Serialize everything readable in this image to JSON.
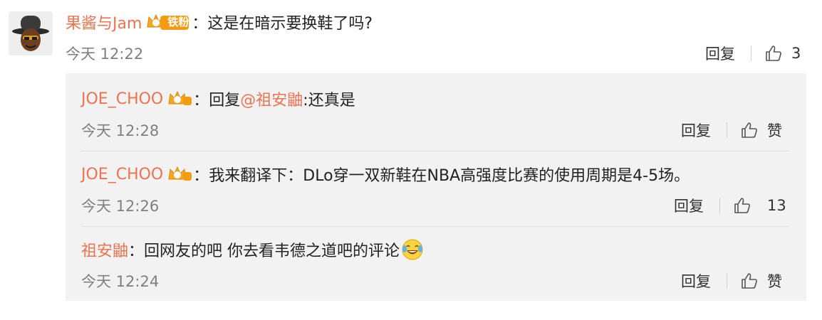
{
  "main_comment": {
    "username": "果酱与Jam",
    "badge_text": "铁粉",
    "separator": "：",
    "text": "这是在暗示要换鞋了吗?",
    "time": "今天 12:22",
    "reply_label": "回复",
    "like_count": "3"
  },
  "replies": [
    {
      "username": "JOE_CHOO",
      "separator": "：",
      "reply_prefix": "回复",
      "mention": "@祖安鼬",
      "text": ":还真是",
      "time": "今天 12:28",
      "reply_label": "回复",
      "like_label": "赞"
    },
    {
      "username": "JOE_CHOO",
      "separator": "：",
      "text": "我来翻译下：DLo穿一双新鞋在NBA高强度比赛的使用周期是4-5场。",
      "time": "今天 12:26",
      "reply_label": "回复",
      "like_count": "13"
    },
    {
      "username": "祖安鼬",
      "separator": "：",
      "text": "回网友的吧 你去看韦德之道吧的评论",
      "time": "今天 12:24",
      "reply_label": "回复",
      "like_label": "赞"
    }
  ],
  "colors": {
    "username": "#eb7350",
    "time": "#808080",
    "panel_bg": "#f2f2f2",
    "crown": "#f5a623"
  },
  "icons": [
    "crown-badge-icon",
    "thumbs-up-icon",
    "laughing-tears-emoji-icon"
  ]
}
